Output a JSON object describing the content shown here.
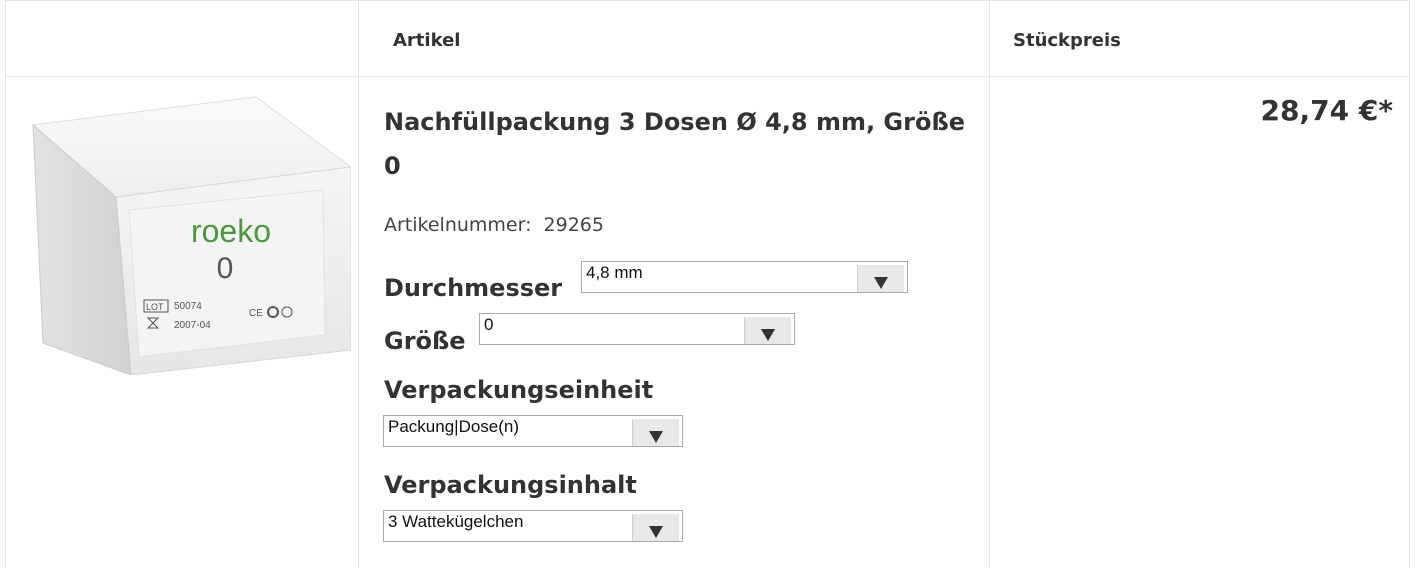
{
  "table": {
    "headers": {
      "image": "",
      "article": "Artikel",
      "unit_price": "Stückpreis"
    }
  },
  "product": {
    "image": {
      "brand": "roeko",
      "size": "0",
      "lot_label": "LOT",
      "lot": "50074",
      "expiry": "2007-04",
      "marks": "CE"
    },
    "title": "Nachfüllpackung 3 Dosen Ø 4,8 mm, Größe 0",
    "article_number_label": "Artikelnummer:",
    "article_number": "29265",
    "options": {
      "diameter": {
        "label": "Durchmesser",
        "value": "4,8 mm"
      },
      "size": {
        "label": "Größe",
        "value": "0"
      },
      "packaging_unit": {
        "label": "Verpackungseinheit",
        "value": "Packung|Dose(n)"
      },
      "packaging_content": {
        "label": "Verpackungsinhalt",
        "value": "3 Wattekügelchen"
      }
    },
    "price": "28,74 €*"
  },
  "colors": {
    "border": "#e3e3e3",
    "text": "#333333",
    "brand_green": "#4a9a3c"
  }
}
